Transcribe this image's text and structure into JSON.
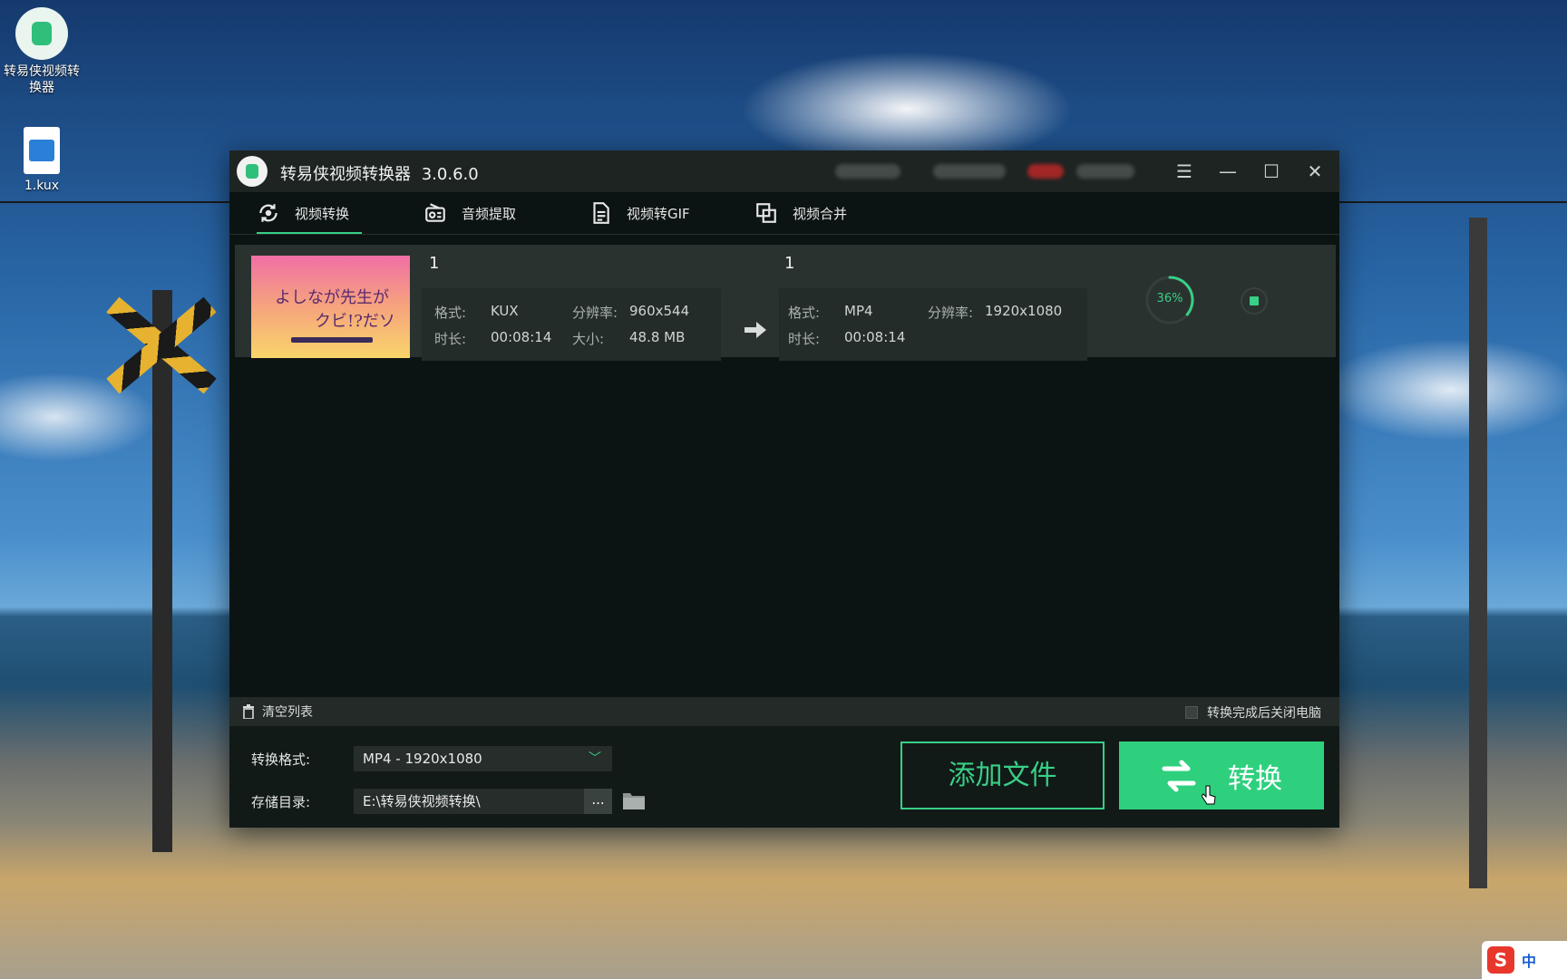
{
  "desktop": {
    "icons": [
      {
        "label": "转易侠视频转\n换器"
      },
      {
        "label": "1.kux"
      }
    ]
  },
  "app": {
    "title": "转易侠视频转换器",
    "version": "3.0.6.0",
    "accent": "#38cf86",
    "tabs": [
      {
        "label": "视频转换",
        "icon": "convert-icon",
        "active": true
      },
      {
        "label": "音频提取",
        "icon": "radio-icon"
      },
      {
        "label": "视频转GIF",
        "icon": "document-icon"
      },
      {
        "label": "视频合并",
        "icon": "merge-icon"
      }
    ],
    "file": {
      "name_src": "1",
      "name_dst": "1",
      "thumbnail_text_1": "よしなが先生が",
      "thumbnail_text_2": "クビ!?だソ",
      "source": {
        "format_label": "格式:",
        "format": "KUX",
        "resolution_label": "分辨率:",
        "resolution": "960x544",
        "duration_label": "时长:",
        "duration": "00:08:14",
        "size_label": "大小:",
        "size": "48.8 MB"
      },
      "target": {
        "format_label": "格式:",
        "format": "MP4",
        "resolution_label": "分辨率:",
        "resolution": "1920x1080",
        "duration_label": "时长:",
        "duration": "00:08:14"
      },
      "progress_label": "36%",
      "progress_value": 0.36
    },
    "bottom": {
      "clear_label": "清空列表",
      "shutdown_label": "转换完成后关闭电脑"
    },
    "footer": {
      "format_label": "转换格式:",
      "format_value": "MP4 - 1920x1080",
      "dir_label": "存储目录:",
      "dir_value": "E:\\转易侠视频转换\\",
      "browse_label": "...",
      "add_label": "添加文件",
      "convert_label": "转换"
    }
  },
  "taskbar": {
    "ime_label": "中"
  }
}
